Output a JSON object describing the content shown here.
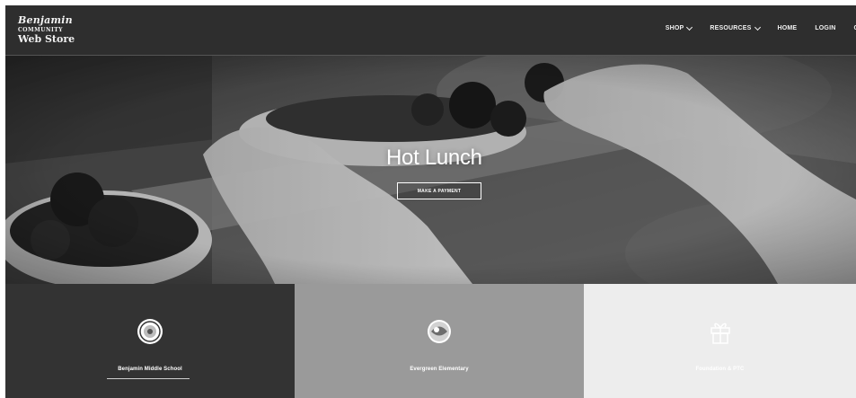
{
  "header": {
    "logo_line1": "Benjamin",
    "logo_line2": "COMMUNITY",
    "logo_line3": "Web Store",
    "nav": [
      {
        "label": "SHOP",
        "dropdown": true
      },
      {
        "label": "RESOURCES",
        "dropdown": true
      },
      {
        "label": "HOME",
        "dropdown": false
      },
      {
        "label": "LOGIN",
        "dropdown": false
      },
      {
        "label": "CA",
        "dropdown": false
      }
    ]
  },
  "hero": {
    "title": "Hot Lunch",
    "button_label": "MAKE A PAYMENT"
  },
  "cards": [
    {
      "label": "Benjamin Middle School",
      "icon": "school-seal-icon",
      "bg": "#333333"
    },
    {
      "label": "Evergreen Elementary",
      "icon": "globe-seal-icon",
      "bg": "#9a9a9a"
    },
    {
      "label": "Foundation & PTC",
      "icon": "gift-icon",
      "bg": "#ededed"
    }
  ]
}
